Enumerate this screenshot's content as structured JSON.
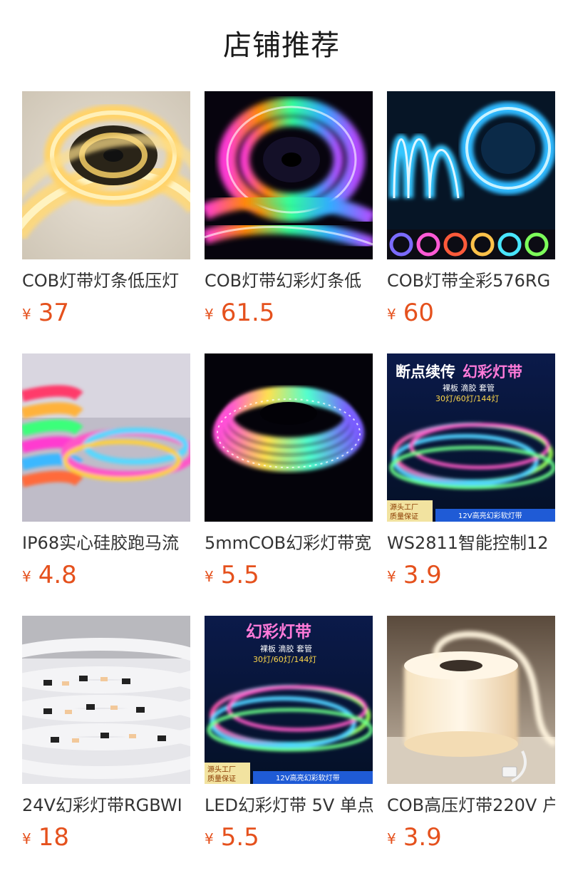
{
  "page": {
    "title": "店铺推荐"
  },
  "products": [
    {
      "name": "COB灯带灯条低压灯",
      "currency": "¥",
      "price": "37",
      "image": "warm-white-cob-strip-reel"
    },
    {
      "name": "COB灯带幻彩灯条低",
      "currency": "¥",
      "price": "61.5",
      "image": "rainbow-cob-strip-reel"
    },
    {
      "name": "COB灯带全彩576RG",
      "currency": "¥",
      "price": "60",
      "image": "blue-cob-strip-color-samples"
    },
    {
      "name": "IP68实心硅胶跑马流",
      "currency": "¥",
      "price": "4.8",
      "image": "silicone-rgb-strip-stack"
    },
    {
      "name": "5mmCOB幻彩灯带宽",
      "currency": "¥",
      "price": "5.5",
      "image": "rainbow-dot-strip-reel"
    },
    {
      "name": "WS2811智能控制12",
      "currency": "¥",
      "price": "3.9",
      "image": "ws2811-strip-banner",
      "banner": {
        "headline": "断点续传",
        "headline_accent": "幻彩灯带",
        "sub": "裸板 滴胶 套管",
        "spec": "30灯/60灯/144灯",
        "badge_line1": "源头工厂",
        "badge_line2": "质量保证",
        "ribbon": "12V高亮幻彩软灯带"
      }
    },
    {
      "name": "24V幻彩灯带RGBWI",
      "currency": "¥",
      "price": "18",
      "image": "white-rgbw-strip-coils"
    },
    {
      "name": "LED幻彩灯带 5V 单点",
      "currency": "¥",
      "price": "5.5",
      "image": "led-strip-banner",
      "banner": {
        "headline_accent": "幻彩灯带",
        "sub": "裸板 滴胶 套管",
        "spec": "30灯/60灯/144灯",
        "badge_line1": "源头工厂",
        "badge_line2": "质量保证",
        "ribbon": "12V高亮幻彩软灯带"
      }
    },
    {
      "name": "COB高压灯带220V 户",
      "currency": "¥",
      "price": "3.9",
      "image": "neon-cob-reel-with-plug"
    }
  ],
  "colors": {
    "price": "#e5511d",
    "title": "#1a1a1a",
    "name": "#333333"
  }
}
